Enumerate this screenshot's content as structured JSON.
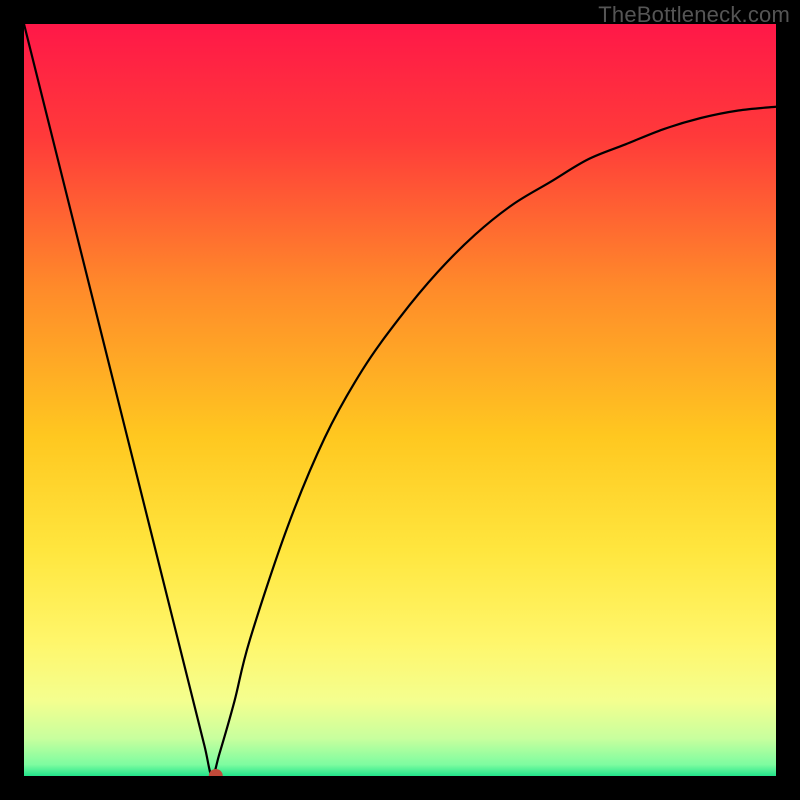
{
  "watermark": "TheBottleneck.com",
  "chart_data": {
    "type": "line",
    "title": "",
    "xlabel": "",
    "ylabel": "",
    "xlim": [
      0,
      100
    ],
    "ylim": [
      0,
      100
    ],
    "x": [
      0,
      5,
      10,
      15,
      20,
      22,
      24,
      25,
      26,
      28,
      30,
      35,
      40,
      45,
      50,
      55,
      60,
      65,
      70,
      75,
      80,
      85,
      90,
      95,
      100
    ],
    "values": [
      100,
      80,
      60,
      40,
      20,
      12,
      4,
      0,
      3,
      10,
      18,
      33,
      45,
      54,
      61,
      67,
      72,
      76,
      79,
      82,
      84,
      86,
      87.5,
      88.5,
      89
    ],
    "marker": {
      "x": 25.5,
      "y": 0
    },
    "background_gradient": {
      "stops": [
        {
          "offset": 0.0,
          "color": "#ff1848"
        },
        {
          "offset": 0.15,
          "color": "#ff3a3a"
        },
        {
          "offset": 0.35,
          "color": "#ff8a2a"
        },
        {
          "offset": 0.55,
          "color": "#ffc820"
        },
        {
          "offset": 0.7,
          "color": "#ffe63e"
        },
        {
          "offset": 0.82,
          "color": "#fff66a"
        },
        {
          "offset": 0.9,
          "color": "#f4ff8f"
        },
        {
          "offset": 0.95,
          "color": "#c8ff9e"
        },
        {
          "offset": 0.985,
          "color": "#7dfca0"
        },
        {
          "offset": 1.0,
          "color": "#22e38a"
        }
      ]
    }
  }
}
